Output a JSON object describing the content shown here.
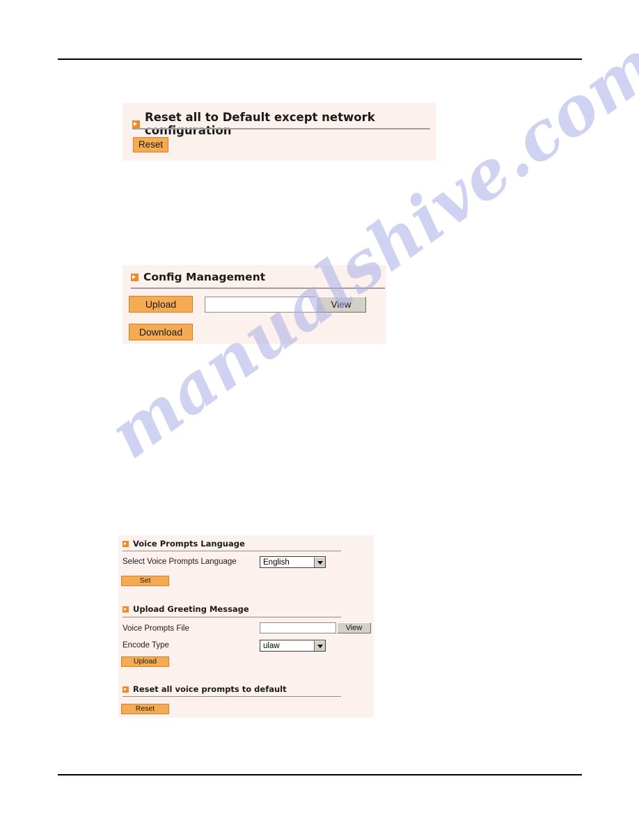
{
  "page": {
    "background_color": "#ffffff",
    "rule_color": "#000000",
    "panel_background": "#fdf1ee",
    "accent_orange": "#f5ab52",
    "accent_orange_border": "#d4802a",
    "bullet_color": "#f08a24"
  },
  "watermark": {
    "text": "manualshive.com",
    "color": "#a9aee4"
  },
  "reset_all_panel": {
    "title": "Reset all to Default except network configuration",
    "bullet_icon": "arrow-right-icon",
    "reset_button": "Reset"
  },
  "config_panel": {
    "title": "Config Management",
    "bullet_icon": "arrow-right-icon",
    "upload_button": "Upload",
    "download_button": "Download",
    "file_input_value": "",
    "file_input_placeholder": "",
    "view_button": "View"
  },
  "voice_panel": {
    "language_section": {
      "title": "Voice Prompts Language",
      "bullet_icon": "arrow-right-icon",
      "select_label": "Select Voice Prompts Language",
      "select_value": "English",
      "select_options": [
        "English"
      ],
      "set_button": "Set"
    },
    "upload_section": {
      "title": "Upload Greeting Message",
      "bullet_icon": "arrow-right-icon",
      "file_label": "Voice Prompts File",
      "file_input_value": "",
      "file_input_placeholder": "",
      "view_button": "View",
      "encode_label": "Encode Type",
      "encode_value": "ulaw",
      "encode_options": [
        "ulaw"
      ],
      "upload_button": "Upload"
    },
    "reset_section": {
      "title": "Reset all voice prompts to default",
      "bullet_icon": "arrow-right-icon",
      "reset_button": "Reset"
    }
  }
}
